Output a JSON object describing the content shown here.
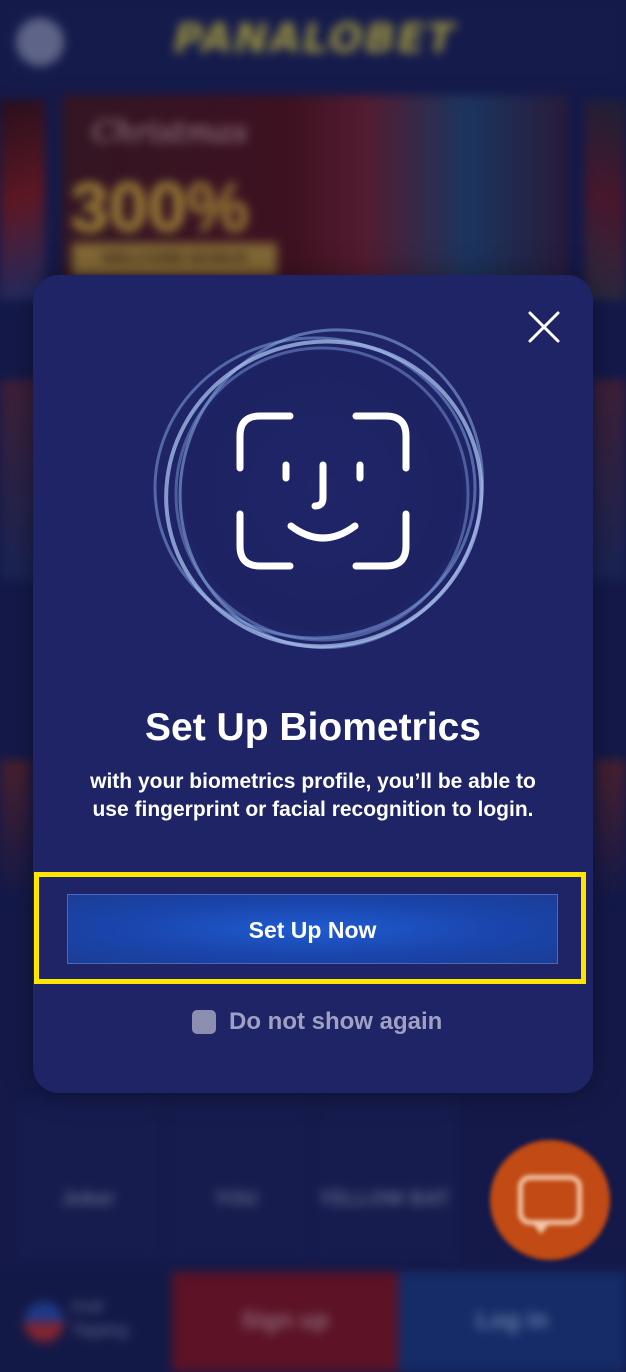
{
  "background": {
    "logo_text": "PANALOBET",
    "banner": {
      "line1": "Christmas",
      "line2": "300%",
      "line3": "WELCOME BONUS"
    },
    "providers": [
      "Joker",
      "YOU",
      "YELLOW BAT"
    ],
    "language": [
      "PHP",
      "Tagalog"
    ],
    "signup_label": "Sign up",
    "login_label": "Log in"
  },
  "modal": {
    "title": "Set Up Biometrics",
    "description": "with your biometrics profile, you’ll be able to use fingerprint or facial recognition to login.",
    "primary_button": "Set Up Now",
    "checkbox_label": "Do not show again"
  },
  "colors": {
    "modal_bg": "#1e2466",
    "primary_button": "#1a45ac",
    "highlight": "#ffe600",
    "chat_button": "#c24a14"
  },
  "icons": {
    "close": "close-icon",
    "biometric": "face-id-icon",
    "chat": "chat-icon"
  }
}
